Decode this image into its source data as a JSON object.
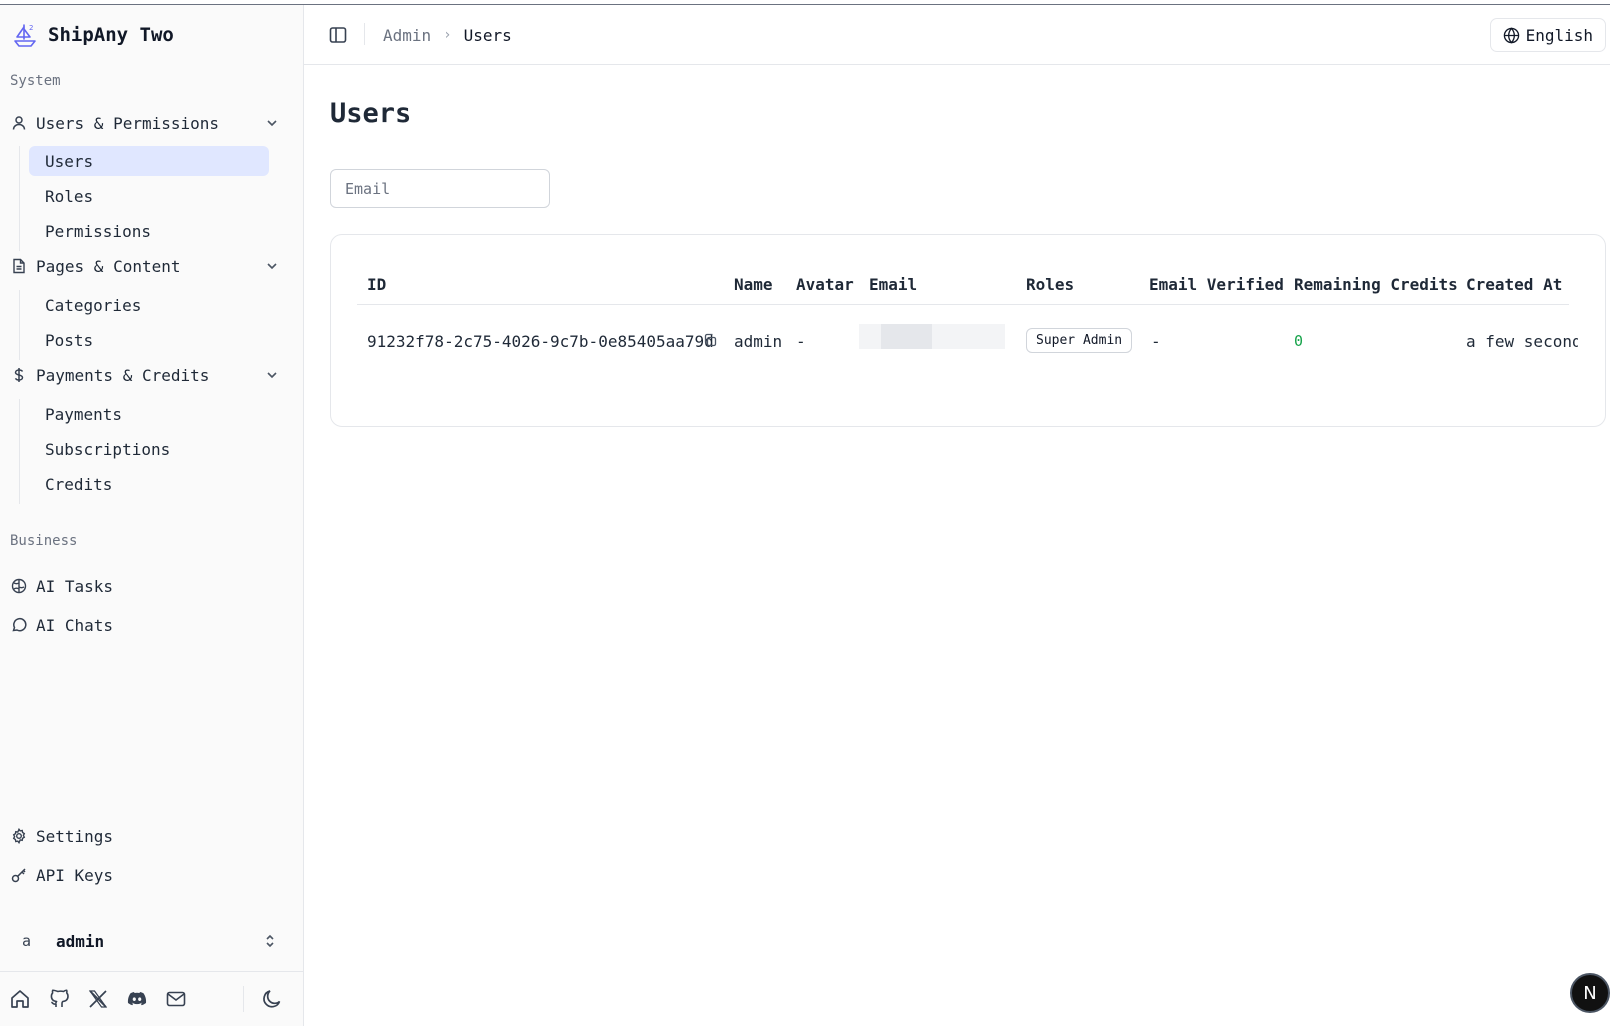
{
  "app": {
    "name": "ShipAny Two"
  },
  "sidebar": {
    "sections": {
      "system": "System",
      "business": "Business"
    },
    "groups": {
      "users_permissions": {
        "label": "Users & Permissions",
        "items": [
          "Users",
          "Roles",
          "Permissions"
        ]
      },
      "pages_content": {
        "label": "Pages & Content",
        "items": [
          "Categories",
          "Posts"
        ]
      },
      "payments_credits": {
        "label": "Payments & Credits",
        "items": [
          "Payments",
          "Subscriptions",
          "Credits"
        ]
      }
    },
    "business_items": [
      "AI Tasks",
      "AI Chats"
    ],
    "bottom_items": [
      "Settings",
      "API Keys"
    ],
    "user": {
      "avatar": "a",
      "name": "admin"
    },
    "footer_icons": [
      "home-icon",
      "github-icon",
      "x-icon",
      "discord-icon",
      "mail-icon",
      "moon-icon"
    ]
  },
  "header": {
    "breadcrumb": {
      "parent": "Admin",
      "separator": "›",
      "current": "Users"
    },
    "language": "English"
  },
  "main": {
    "title": "Users",
    "search": {
      "placeholder": "Email",
      "value": ""
    },
    "table": {
      "columns": [
        "ID",
        "Name",
        "Avatar",
        "Email",
        "Roles",
        "Email Verified",
        "Remaining Credits",
        "Created At"
      ],
      "rows": [
        {
          "id": "91232f78-2c75-4026-9c7b-0e85405aa79d",
          "name": "admin",
          "avatar": "-",
          "email": "",
          "role": "Super Admin",
          "email_verified": "-",
          "remaining_credits": "0",
          "created_at": "a few seconds ago"
        }
      ]
    }
  },
  "overlay": {
    "next_badge": "N"
  },
  "colors": {
    "active_bg": "#e0e7ff",
    "credits": "#16a34a",
    "accent": "#6366f1"
  }
}
